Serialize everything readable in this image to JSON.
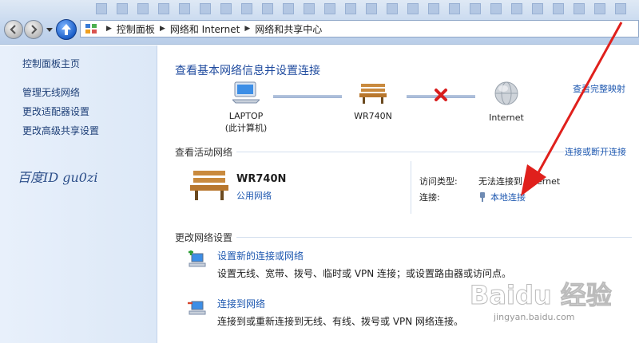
{
  "address": {
    "breadcrumbs": [
      "控制面板",
      "网络和 Internet",
      "网络和共享中心"
    ]
  },
  "sidebar": {
    "home": "控制面板主页",
    "items": [
      {
        "label": "管理无线网络"
      },
      {
        "label": "更改适配器设置"
      },
      {
        "label": "更改高级共享设置"
      }
    ],
    "watermark_text": "百度ID gu0zi"
  },
  "main": {
    "title": "查看基本网络信息并设置连接",
    "view_full_map": "查看完整映射",
    "map": {
      "laptop_label_1": "LAPTOP",
      "laptop_label_2": "(此计算机)",
      "router_label": "WR740N",
      "internet_label": "Internet"
    },
    "active_section": "查看活动网络",
    "connect_disconnect": "连接或断开连接",
    "network": {
      "name": "WR740N",
      "type": "公用网络",
      "access_type_label": "访问类型:",
      "access_type_value": "无法连接到 Internet",
      "connection_label": "连接:",
      "connection_value": "本地连接"
    },
    "change_section": "更改网络设置",
    "tasks": [
      {
        "link": "设置新的连接或网络",
        "desc": "设置无线、宽带、拨号、临时或 VPN 连接；或设置路由器或访问点。"
      },
      {
        "link": "连接到网络",
        "desc": "连接到或重新连接到无线、有线、拨号或 VPN 网络连接。"
      }
    ]
  },
  "watermark": {
    "logo": "Baidu 经验",
    "url": "jingyan.baidu.com"
  },
  "colors": {
    "link": "#1e58b0",
    "title": "#1e4a9e",
    "arrow": "#e0201c"
  }
}
